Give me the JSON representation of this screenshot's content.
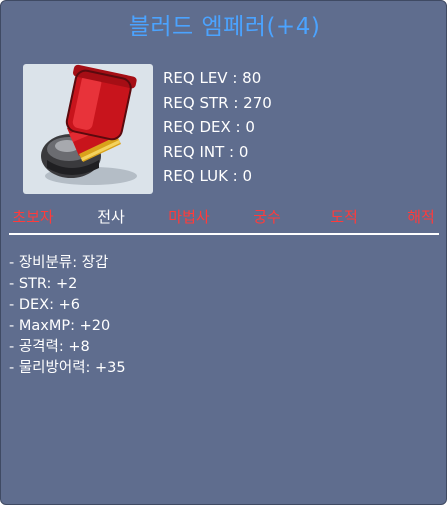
{
  "item": {
    "name": "블러드 엠페러(+4)",
    "icon": "red-helmet-gauntlet-icon"
  },
  "requirements": [
    "REQ LEV : 80",
    "REQ STR : 270",
    "REQ DEX : 0",
    "REQ INT : 0",
    "REQ LUK : 0"
  ],
  "jobs": [
    {
      "label": "초보자",
      "allowed": false
    },
    {
      "label": "전사",
      "allowed": true
    },
    {
      "label": "마법사",
      "allowed": false
    },
    {
      "label": "궁수",
      "allowed": false
    },
    {
      "label": "도적",
      "allowed": false
    },
    {
      "label": "해적",
      "allowed": false
    }
  ],
  "stats": [
    "- 장비분류: 장갑",
    "- STR: +2",
    "- DEX: +6",
    "- MaxMP: +20",
    "- 공격력: +8",
    "- 물리방어력: +35"
  ],
  "colors": {
    "background": "#5f6d8e",
    "title": "#4ba3ff",
    "job_allowed": "#ffffff",
    "job_disallowed": "#ff3b3b"
  }
}
